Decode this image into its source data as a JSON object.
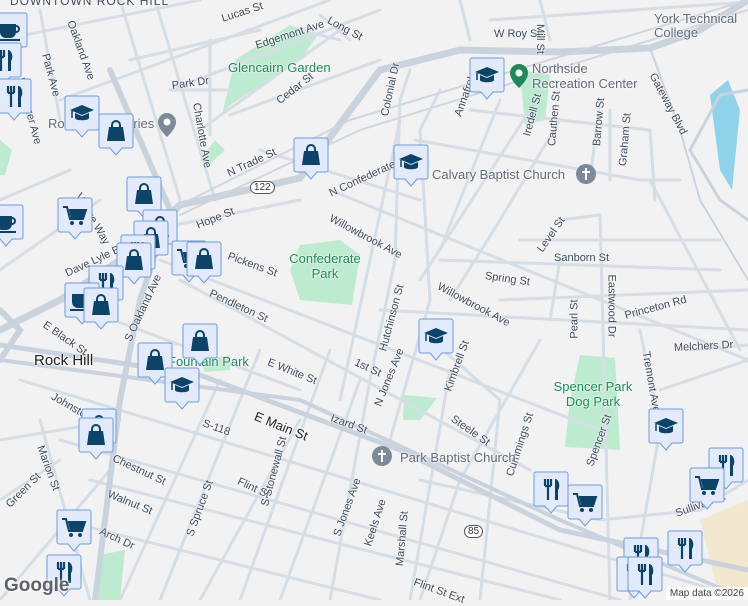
{
  "map": {
    "neighborhood": "DOWNTOWN ROCK HILL",
    "city": "Rock Hill",
    "streets": [
      "Lucas St",
      "Edgemont Ave",
      "Long St",
      "Oakland Ave",
      "Park Ave",
      "Ebenezer Ave",
      "Park Dr",
      "Charlotte Ave",
      "Cedar St",
      "N Trade St",
      "N Confederate Ave",
      "Willowbrook Ave",
      "Hope St",
      "Pickens St",
      "Pendleton St",
      "Village Way",
      "Dave Lyle Blvd",
      "S Oakland Ave",
      "E Black St",
      "Johnston St",
      "E White St",
      "S-118",
      "E Main St",
      "Izard St",
      "1st St",
      "N Jones Ave",
      "Hutchinson St",
      "Kimbrell St",
      "Steele St",
      "Chestnut St",
      "Flint St",
      "S Spruce St",
      "S Stonewall St",
      "S Jones Ave",
      "Keels Ave",
      "Marshall St",
      "Walnut St",
      "Arch Dr",
      "Green St",
      "Marion St",
      "Flint St Ext",
      "W Roy St",
      "Mill St",
      "Colonial Dr",
      "Annafrel St",
      "Iredell St",
      "Cauthen St",
      "Barrow St",
      "Graham St",
      "Gateway Blvd",
      "Spring St",
      "Level St",
      "Sanborn St",
      "Pearl St",
      "Eastwood Dr",
      "Princeton Rd",
      "Melchers Dr",
      "Tremont Ave",
      "Cummings St",
      "Spencer St",
      "Sullivan St",
      "Willowbrook Ave"
    ],
    "parks": [
      "Glencairn Garden",
      "Confederate Park",
      "Fountain Park",
      "Spencer Park Dog Park"
    ],
    "pois": [
      "Northside Recreation Center",
      "Calvary Baptist Church",
      "Park Baptist Church",
      "York Technical College",
      "Rock Hill Galleries"
    ],
    "route_shields": [
      "122",
      "85"
    ],
    "markers": [
      "cafe",
      "restaurant",
      "restaurant",
      "school",
      "shopping",
      "shopping",
      "school",
      "school",
      "grocery",
      "cafe",
      "shopping",
      "shopping",
      "shopping",
      "restaurant",
      "shopping",
      "grocery",
      "shopping",
      "restaurant",
      "cafe",
      "shopping",
      "shopping",
      "shopping",
      "school",
      "shopping",
      "shopping",
      "school",
      "school",
      "restaurant",
      "grocery",
      "restaurant",
      "grocery",
      "grocery",
      "restaurant",
      "restaurant",
      "restaurant",
      "restaurant",
      "restaurant"
    ],
    "logo": "Google",
    "attribution": "Map data ©2026"
  },
  "colors": {
    "background": "#f3f2f3",
    "road": "#d5dde5",
    "major_road": "#c9d3dd",
    "park": "#bdebcf",
    "water": "#8fd3ea",
    "marker_fill": "#e2eafb",
    "marker_stroke": "#6a9be0",
    "icon": "#0b4468"
  }
}
